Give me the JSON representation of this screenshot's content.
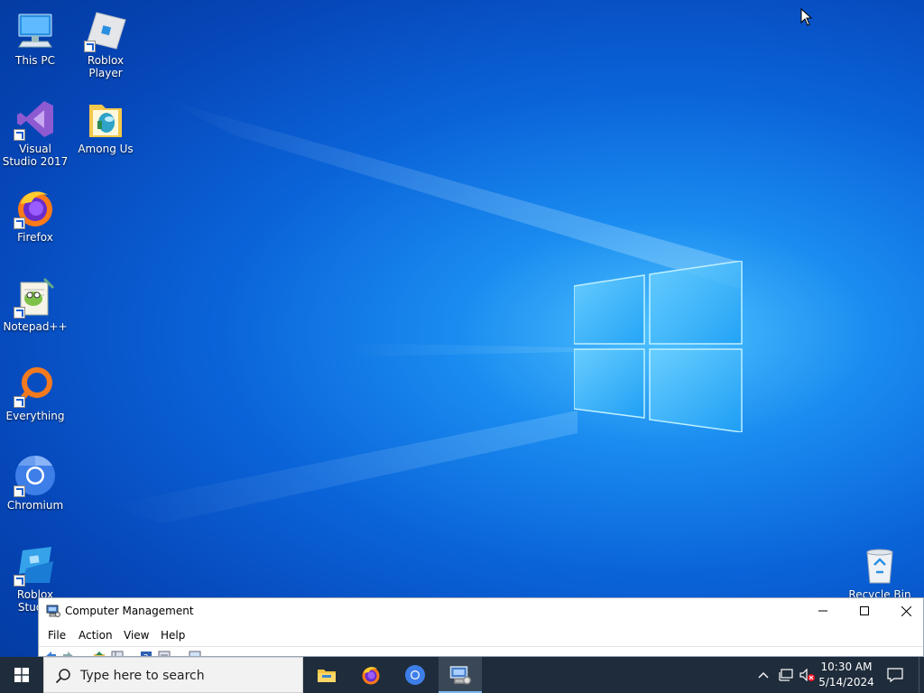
{
  "desktop": {
    "icons_left": [
      {
        "label": "This PC",
        "icon": "this-pc-icon"
      },
      {
        "label": "Visual Studio 2017",
        "icon": "visual-studio-icon"
      },
      {
        "label": "Firefox",
        "icon": "firefox-icon"
      },
      {
        "label": "Notepad++",
        "icon": "notepadpp-icon"
      },
      {
        "label": "Everything",
        "icon": "everything-icon"
      },
      {
        "label": "Chromium",
        "icon": "chromium-icon"
      },
      {
        "label": "Roblox Studio",
        "icon": "roblox-studio-icon"
      }
    ],
    "icons_col2": [
      {
        "label": "Roblox Player",
        "icon": "roblox-player-icon"
      },
      {
        "label": "Among Us",
        "icon": "among-us-folder-icon"
      }
    ],
    "recycle_bin": {
      "label": "Recycle Bin",
      "icon": "recycle-bin-icon"
    }
  },
  "window": {
    "title": "Computer Management",
    "menu": [
      "File",
      "Action",
      "View",
      "Help"
    ],
    "controls": {
      "minimize": "minimize-icon",
      "maximize": "maximize-icon",
      "close": "close-icon"
    }
  },
  "taskbar": {
    "search_placeholder": "Type here to search",
    "apps": [
      {
        "name": "File Explorer",
        "icon": "file-explorer-icon"
      },
      {
        "name": "Firefox",
        "icon": "firefox-icon"
      },
      {
        "name": "Chromium",
        "icon": "chromium-icon"
      },
      {
        "name": "Computer Management",
        "icon": "computer-management-icon",
        "active": true
      }
    ],
    "tray": {
      "time": "10:30 AM",
      "date": "5/14/2024",
      "icons": [
        "chevron-up-icon",
        "network-icon",
        "volume-muted-icon",
        "notification-icon"
      ]
    }
  },
  "colors": {
    "taskbar_bg": "#1f2c3b",
    "desktop_accent": "#0a63d8",
    "window_border": "#9aa6b8"
  }
}
